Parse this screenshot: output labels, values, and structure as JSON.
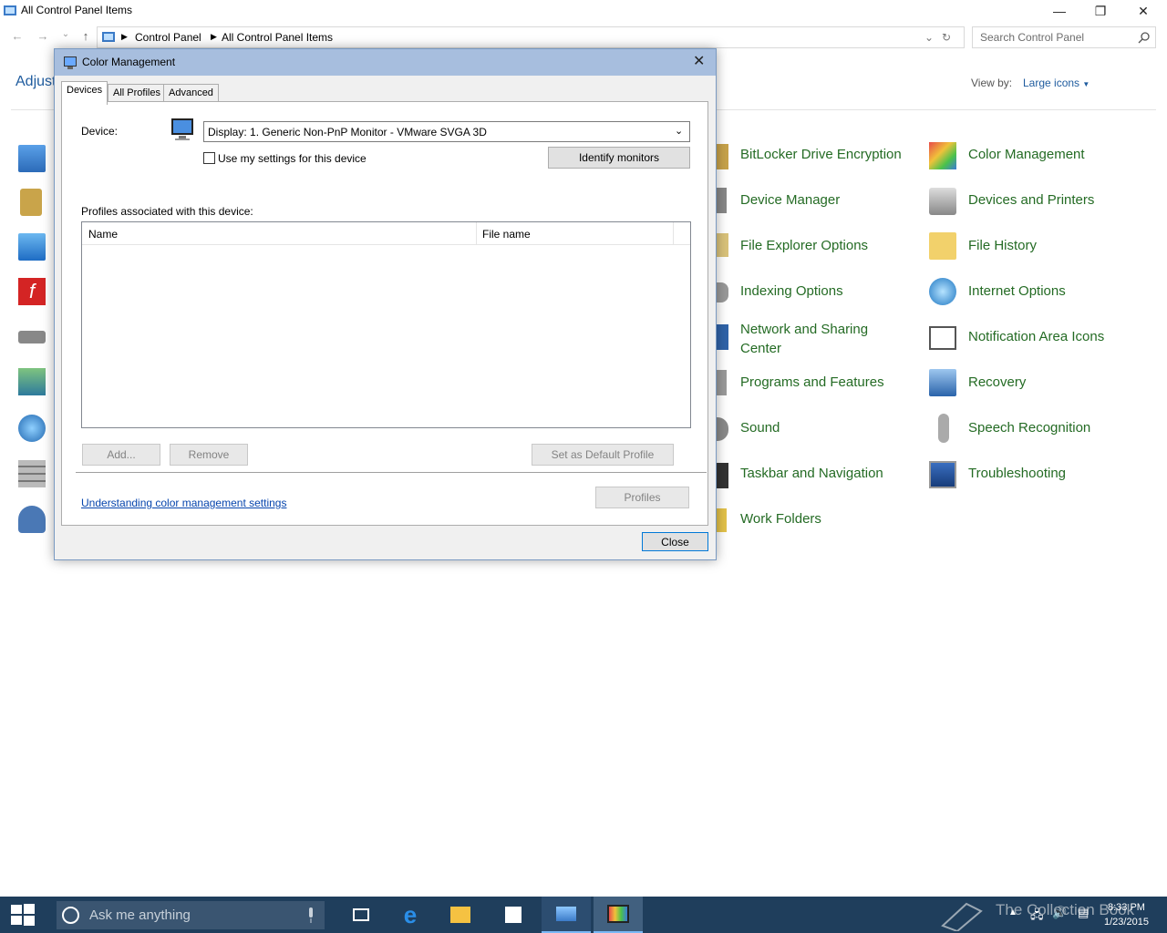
{
  "window": {
    "title": "All Control Panel Items",
    "controls": {
      "minimize": "—",
      "restore": "❐",
      "close": "✕"
    }
  },
  "address_bar": {
    "crumbs": [
      "Control Panel",
      "All Control Panel Items"
    ],
    "search_placeholder": "Search Control Panel"
  },
  "content": {
    "heading_partial": "Adjust",
    "view_by_label": "View by:",
    "view_by_value": "Large icons",
    "items_col3": [
      "BitLocker Drive Encryption",
      "Device Manager",
      "File Explorer Options",
      "Indexing Options",
      "Network and Sharing Center",
      "Programs and Features",
      "Sound",
      "Taskbar and Navigation",
      "Work Folders"
    ],
    "items_col4": [
      "Color Management",
      "Devices and Printers",
      "File History",
      "Internet Options",
      "Notification Area Icons",
      "Recovery",
      "Speech Recognition",
      "Troubleshooting"
    ]
  },
  "dialog": {
    "title": "Color Management",
    "tabs": [
      "Devices",
      "All Profiles",
      "Advanced"
    ],
    "device_label": "Device:",
    "device_value": "Display: 1. Generic Non-PnP Monitor - VMware SVGA 3D",
    "use_my_settings": "Use my settings for this device",
    "identify_monitors": "Identify monitors",
    "profiles_label": "Profiles associated with this device:",
    "columns": [
      "Name",
      "File name"
    ],
    "add_button": "Add...",
    "remove_button": "Remove",
    "set_default_button": "Set as Default Profile",
    "help_link": "Understanding color management settings",
    "profiles_button": "Profiles",
    "close_button": "Close"
  },
  "taskbar": {
    "search_placeholder": "Ask me anything",
    "clock_time": "8:33 PM",
    "clock_date": "1/23/2015",
    "watermark": "The Collection Book"
  }
}
